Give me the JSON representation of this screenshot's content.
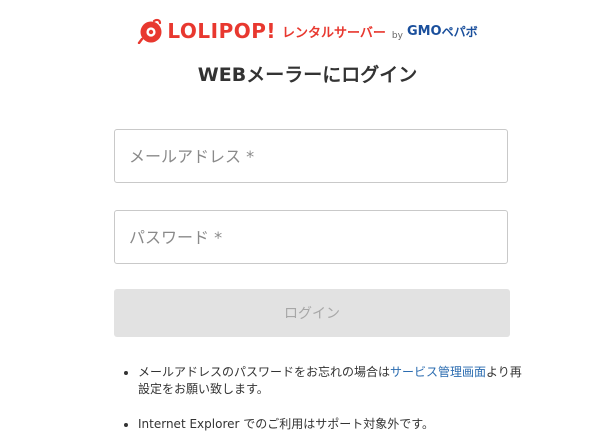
{
  "brand": {
    "name": "LOLIPOP!",
    "service": "レンタルサーバー",
    "by": "by",
    "parent_gmo": "GMO",
    "parent_name": "ペパボ",
    "color": "#e8382f",
    "parent_color": "#1a4f9c"
  },
  "page": {
    "title": "WEBメーラーにログイン"
  },
  "form": {
    "email_placeholder": "メールアドレス *",
    "password_placeholder": "パスワード *",
    "login_label": "ログイン"
  },
  "notes": {
    "forgot_prefix": "メールアドレスのパスワードをお忘れの場合は",
    "forgot_link": "サービス管理画面",
    "forgot_suffix": "より再設定をお願い致します。",
    "ie_notice": "Internet Explorer でのご利用はサポート対象外です。"
  },
  "icons": {
    "logo": "lollipop-logo-icon"
  }
}
